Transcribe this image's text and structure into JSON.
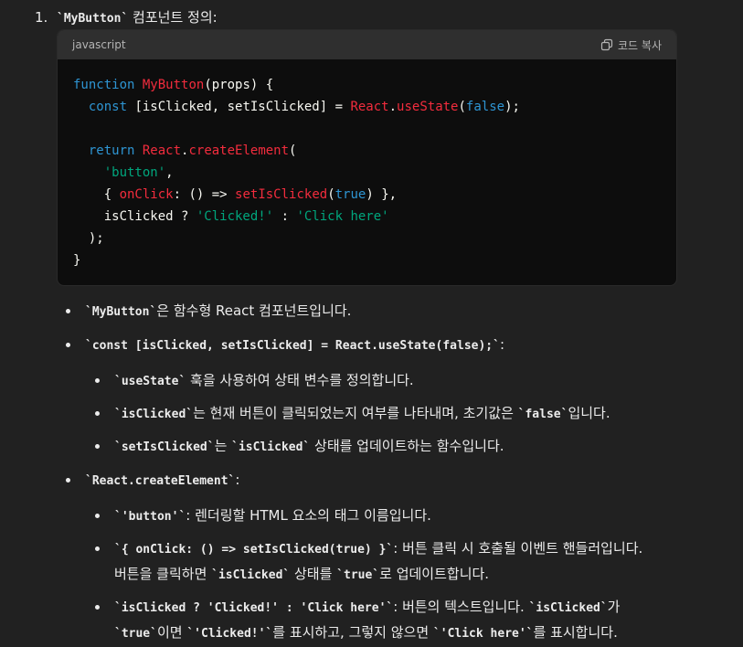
{
  "heading": {
    "number": "1.",
    "code": "`MyButton`",
    "text": " 컴포넌트 정의:"
  },
  "code_block": {
    "language": "javascript",
    "copy_label": "코드 복사",
    "copy_icon": "copy-icon"
  },
  "bullets": {
    "b1": {
      "code": "`MyButton`",
      "text": "은 함수형 React 컴포넌트입니다."
    },
    "b2": {
      "code": "`const [isClicked, setIsClicked] = React.useState(false);`",
      "text": ":"
    },
    "b2_1": {
      "code": "`useState`",
      "text": " 훅을 사용하여 상태 변수를 정의합니다."
    },
    "b2_2": {
      "code1": "`isClicked`",
      "text1": "는 현재 버튼이 클릭되었는지 여부를 나타내며, 초기값은 ",
      "code2": "`false`",
      "text2": "입니다."
    },
    "b2_3": {
      "code1": "`setIsClicked`",
      "text1": "는 ",
      "code2": "`isClicked`",
      "text2": " 상태를 업데이트하는 함수입니다."
    },
    "b3": {
      "code": "`React.createElement`",
      "text": ":"
    },
    "b3_1": {
      "code": "`'button'`",
      "text": ": 렌더링할 HTML 요소의 태그 이름입니다."
    },
    "b3_2": {
      "code": "`{ onClick: () => setIsClicked(true) }`",
      "text": ": 버튼 클릭 시 호출될 이벤트 핸들러입니다."
    },
    "b3_2c": {
      "text1": "버튼을 클릭하면 ",
      "code1": "`isClicked`",
      "text2": " 상태를 ",
      "code2": "`true`",
      "text3": "로 업데이트합니다."
    },
    "b3_3": {
      "code1": "`isClicked ? 'Clicked!' : 'Click here'`",
      "text1": ": 버튼의 텍스트입니다. ",
      "code2": "`isClicked`",
      "text2": "가"
    },
    "b3_3c": {
      "code1": "`true`",
      "text1": "이면 ",
      "code2": "`'Clicked!'`",
      "text2": "를 표시하고, 그렇지 않으면 ",
      "code3": "`'Click here'`",
      "text3": "를 표시합니다."
    }
  }
}
